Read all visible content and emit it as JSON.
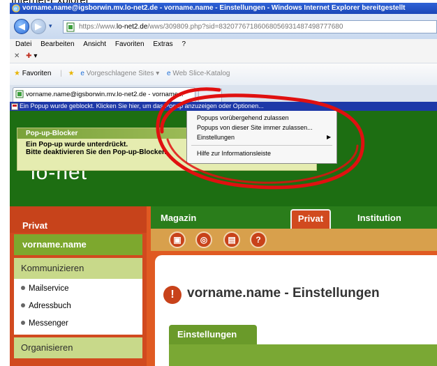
{
  "caption_cut": "Internet-Explorer",
  "window": {
    "title": "vorname.name@igsborwin.mv.lo-net2.de - vorname.name - Einstellungen - Windows Internet Explorer bereitgestellt"
  },
  "address": {
    "url_prefix": "https://www.",
    "url_domain": "lo-net2.de",
    "url_rest": "/wws/309809.php?sid=83207767186068056931487498777680"
  },
  "menu": [
    "Datei",
    "Bearbeiten",
    "Ansicht",
    "Favoriten",
    "Extras",
    "?"
  ],
  "favorites_bar": {
    "favorites_label": "Favoriten",
    "suggested_sites": "Vorgeschlagene Sites ▾",
    "web_slice": "Web Slice-Katalog"
  },
  "tab": {
    "label": "vorname.name@igsborwin.mv.lo-net2.de - vorname..."
  },
  "infobar": {
    "text": "Ein Popup wurde geblockt. Klicken Sie hier, um das Popup anzuzeigen oder Optionen..."
  },
  "popup_blocker": {
    "header": "Pop-up-Blocker",
    "line1": "Ein Pop-up wurde unterdrückt.",
    "line2": "Bitte deaktivieren Sie den Pop-up-Blocker."
  },
  "logo": "lo-net",
  "context_menu": {
    "item1": "Popups vorübergehend zulassen",
    "item2": "Popups von dieser Site immer zulassen...",
    "item3": "Einstellungen",
    "item4": "Hilfe zur Informationsleiste"
  },
  "leftnav": {
    "header": "Privat",
    "user": "vorname.name",
    "section1": "Kommunizieren",
    "links": [
      "Mailservice",
      "Adressbuch",
      "Messenger"
    ],
    "section2": "Organisieren"
  },
  "topnav": {
    "magazin": "Magazin",
    "privat": "Privat",
    "institution": "Institution"
  },
  "content": {
    "title": "vorname.name - Einstellungen",
    "tab": "Einstellungen"
  },
  "colors": {
    "green_band": "#1d6e12",
    "orange": "#d14a1f",
    "annotation_red": "#e01010"
  }
}
